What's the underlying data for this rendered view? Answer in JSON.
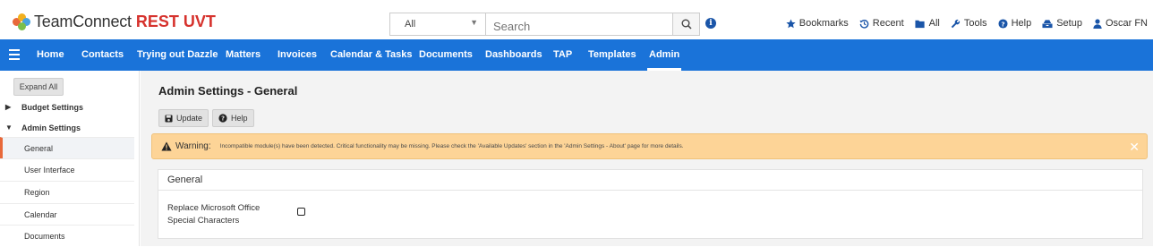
{
  "header": {
    "app_name": "TeamConnect",
    "app_env": "REST UVT",
    "search": {
      "scope": "All",
      "placeholder": "Search"
    },
    "links": [
      {
        "label": "Bookmarks",
        "icon": "star-icon"
      },
      {
        "label": "Recent",
        "icon": "history-icon"
      },
      {
        "label": "All",
        "icon": "folder-icon"
      },
      {
        "label": "Tools",
        "icon": "wrench-icon"
      },
      {
        "label": "Help",
        "icon": "help-circle-icon"
      },
      {
        "label": "Setup",
        "icon": "setup-icon"
      },
      {
        "label": "Oscar FN",
        "icon": "user-icon"
      }
    ]
  },
  "nav": {
    "items": [
      {
        "label": "Home"
      },
      {
        "label": "Contacts"
      },
      {
        "label": "Trying out Dazzle"
      },
      {
        "label": "Matters"
      },
      {
        "label": "Invoices"
      },
      {
        "label": "Calendar & Tasks"
      },
      {
        "label": "Documents"
      },
      {
        "label": "Dashboards"
      },
      {
        "label": "TAP"
      },
      {
        "label": "Templates"
      },
      {
        "label": "Admin",
        "active": true
      }
    ]
  },
  "sidebar": {
    "expand_all": "Expand All",
    "groups": [
      {
        "label": "Budget Settings",
        "expanded": false
      },
      {
        "label": "Admin Settings",
        "expanded": true
      }
    ],
    "items": [
      {
        "label": "General",
        "active": true
      },
      {
        "label": "User Interface"
      },
      {
        "label": "Region"
      },
      {
        "label": "Calendar"
      },
      {
        "label": "Documents"
      }
    ]
  },
  "main": {
    "title": "Admin Settings - General",
    "update_label": "Update",
    "help_label": "Help",
    "warning": {
      "label": "Warning:",
      "message": "Incompatible module(s) have been detected. Critical functionality may be missing. Please check the 'Available Updates' section in the 'Admin Settings - About' page for more details."
    },
    "panel": {
      "title": "General",
      "field_label_line1": "Replace Microsoft Office",
      "field_label_line2": "Special Characters",
      "checked": false
    }
  },
  "colors": {
    "nav_bg": "#1a73d9",
    "warning_bg": "#fdd497",
    "active_accent": "#e8693a",
    "brand_red": "#d6322d"
  }
}
